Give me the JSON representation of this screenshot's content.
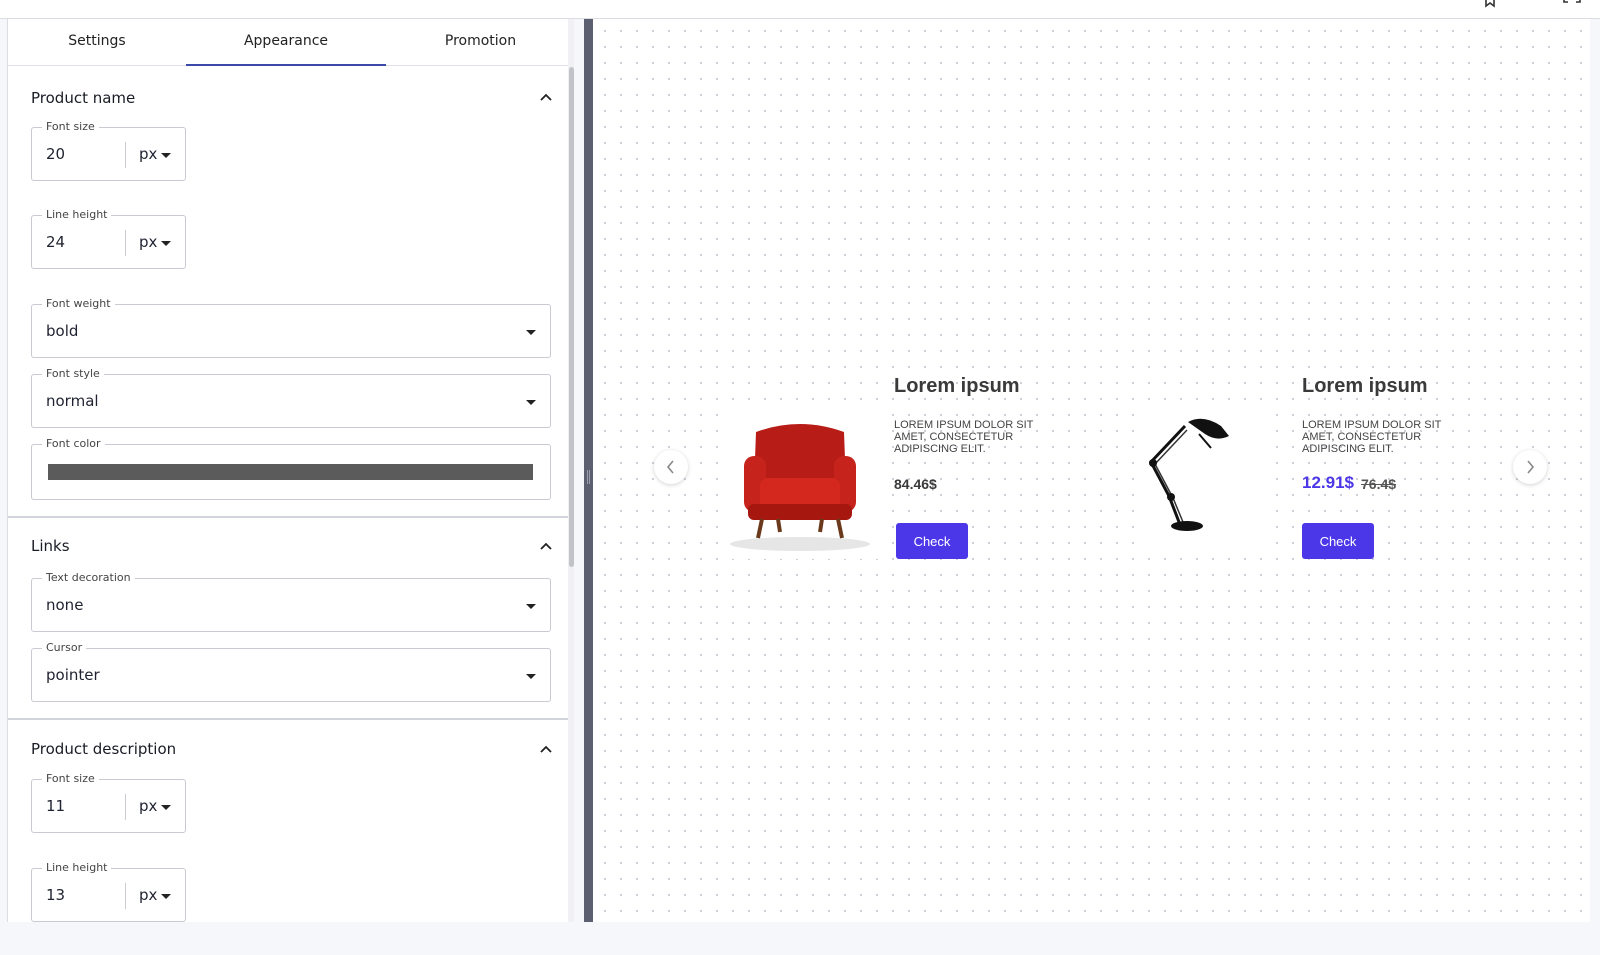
{
  "tabs": [
    {
      "label": "Settings"
    },
    {
      "label": "Appearance"
    },
    {
      "label": "Promotion"
    }
  ],
  "topbar": {
    "icons": [
      "bookmark-icon",
      "more-icon",
      "fullscreen-icon"
    ]
  },
  "sections": {
    "product_name": {
      "title": "Product name",
      "font_size": {
        "label": "Font size",
        "value": "20",
        "unit": "px"
      },
      "line_height": {
        "label": "Line height",
        "value": "24",
        "unit": "px"
      },
      "font_weight": {
        "label": "Font weight",
        "value": "bold"
      },
      "font_style": {
        "label": "Font style",
        "value": "normal"
      },
      "font_color": {
        "label": "Font color",
        "value": "#5b5b5b"
      }
    },
    "links": {
      "title": "Links",
      "text_decoration": {
        "label": "Text decoration",
        "value": "none"
      },
      "cursor": {
        "label": "Cursor",
        "value": "pointer"
      }
    },
    "product_description": {
      "title": "Product description",
      "font_size": {
        "label": "Font size",
        "value": "11",
        "unit": "px"
      },
      "line_height": {
        "label": "Line height",
        "value": "13",
        "unit": "px"
      }
    }
  },
  "preview": {
    "products": [
      {
        "title": "Lorem ipsum",
        "description": "LOREM IPSUM DOLOR SIT AMET, CONSECTETUR ADIPISCING ELIT.",
        "price": "84.46$",
        "button": "Check",
        "image": "armchair"
      },
      {
        "title": "Lorem ipsum",
        "description": "LOREM IPSUM DOLOR SIT AMET, CONSECTETUR ADIPISCING ELIT.",
        "price": "12.91$",
        "old_price": "76.4$",
        "button": "Check",
        "image": "desk-lamp"
      }
    ]
  },
  "colors": {
    "accent": "#4c37e8",
    "tab_indicator": "#3b49a8",
    "divider": "#5c5f70"
  }
}
